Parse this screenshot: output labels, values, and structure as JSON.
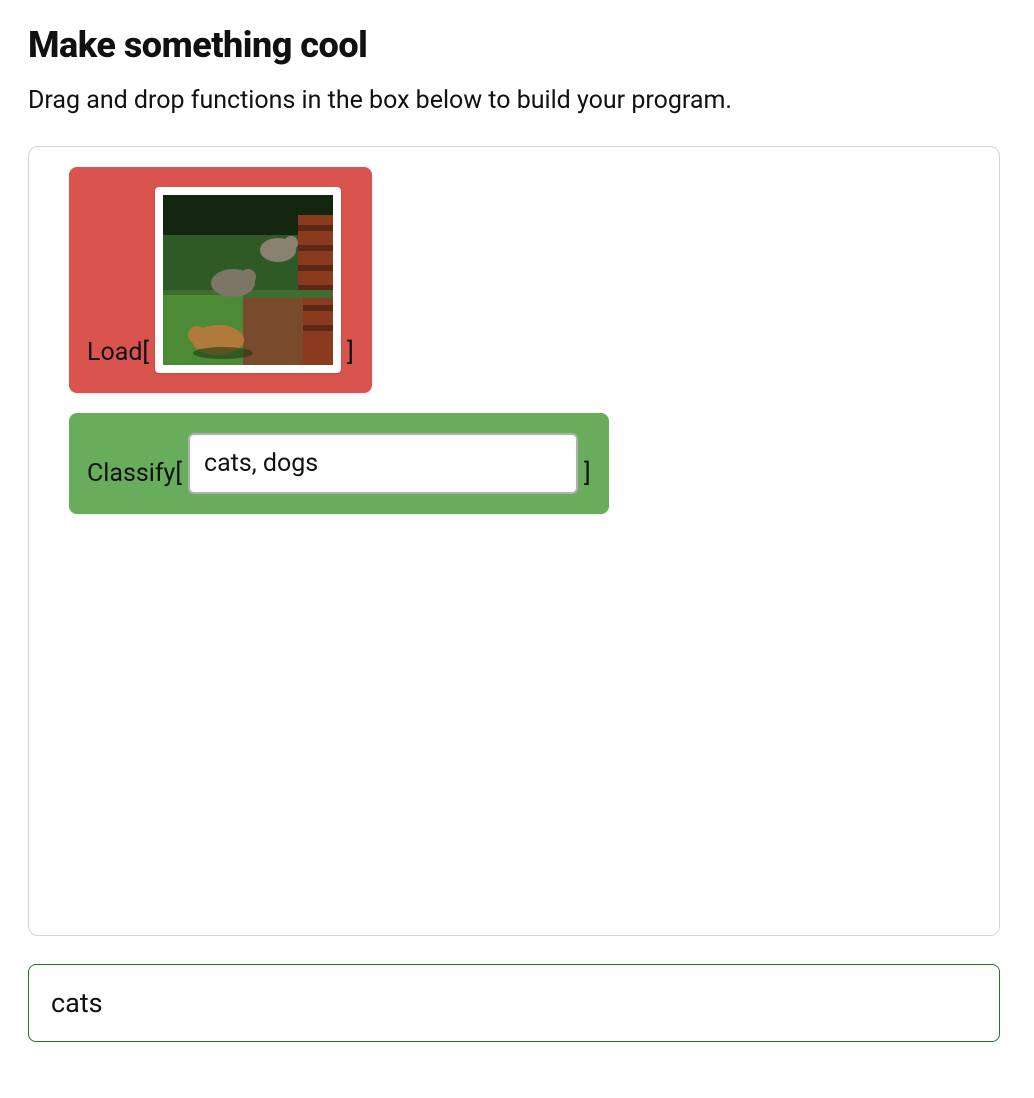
{
  "header": {
    "title": "Make something cool",
    "subtitle": "Drag and drop functions in the box below to build your program."
  },
  "builder": {
    "blocks": {
      "load": {
        "label_open": "Load[",
        "label_close": "]",
        "has_image": true
      },
      "classify": {
        "label_open": "Classify[",
        "label_close": "]",
        "input_value": "cats, dogs"
      }
    }
  },
  "result": {
    "text": "cats"
  }
}
